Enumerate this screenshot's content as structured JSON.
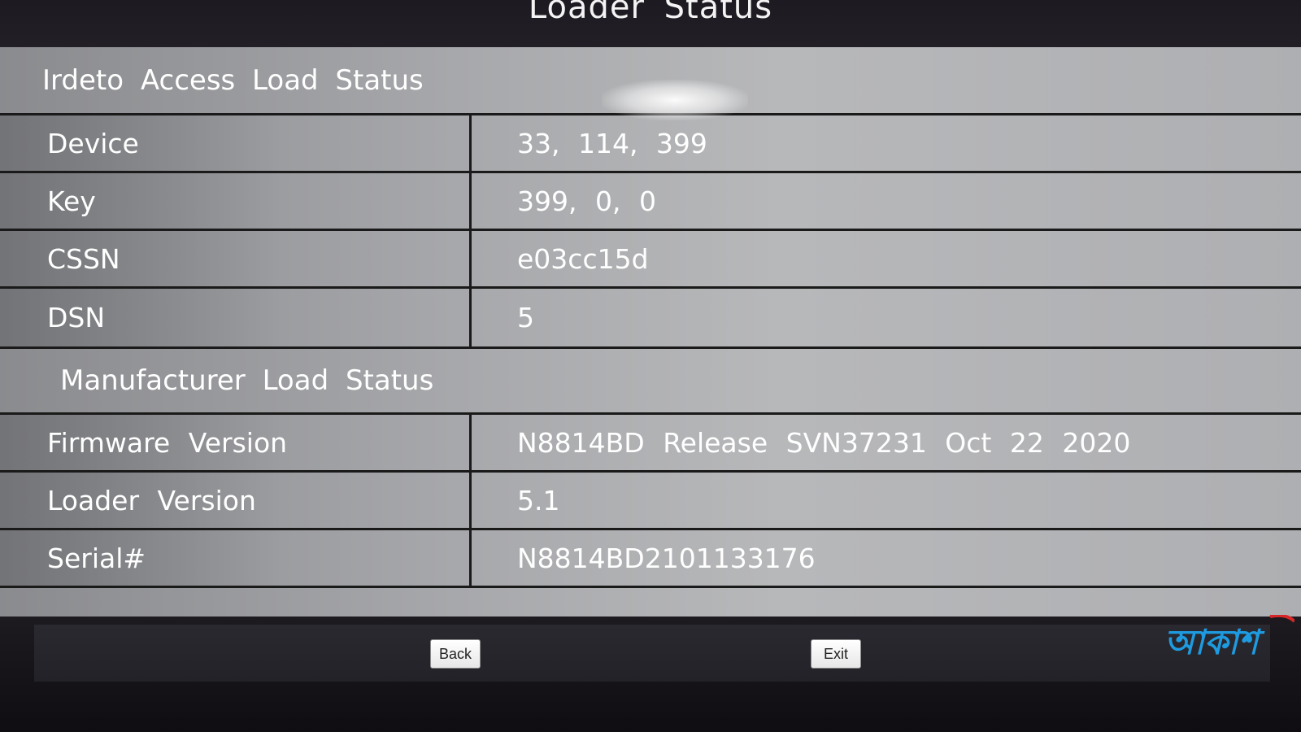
{
  "title": "Loader Status",
  "irdeto_section": {
    "header": "Irdeto Access Load Status",
    "rows": [
      {
        "label": "Device",
        "value": "33, 114, 399"
      },
      {
        "label": "Key",
        "value": "399, 0, 0"
      },
      {
        "label": "CSSN",
        "value": "e03cc15d"
      },
      {
        "label": "DSN",
        "value": "5"
      }
    ]
  },
  "manufacturer_section": {
    "header": "Manufacturer Load Status",
    "rows": [
      {
        "label": "Firmware Version",
        "value": "N8814BD Release SVN37231 Oct 22 2020"
      },
      {
        "label": "Loader Version",
        "value": "5.1"
      },
      {
        "label": "Serial#",
        "value": "N8814BD2101133176"
      }
    ]
  },
  "buttons": {
    "back": "Back",
    "exit": "Exit"
  },
  "logo": {
    "text": "আকাশ",
    "color": "#1e9be0",
    "accent": "#d62828"
  }
}
